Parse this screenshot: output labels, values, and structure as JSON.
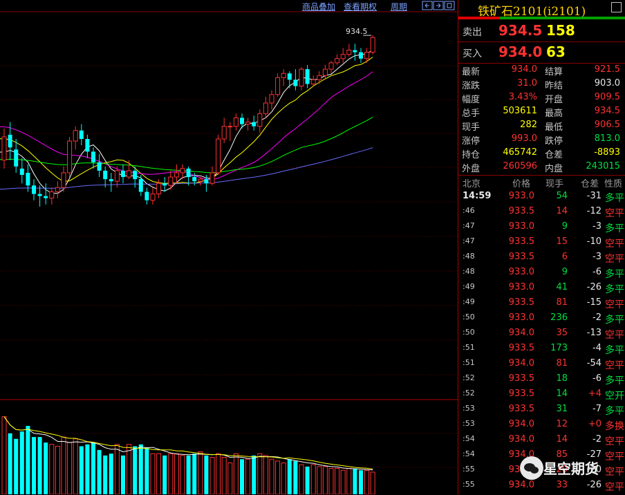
{
  "toolbar": {
    "overlay_label": "商品叠加",
    "history_label": "查看期权",
    "period_label": "周期"
  },
  "chart": {
    "high_label": "934.5",
    "candles": [
      {
        "o": 905.0,
        "c": 910.5,
        "h": 912.5,
        "l": 903.0
      },
      {
        "o": 911.0,
        "c": 908.0,
        "h": 914.0,
        "l": 905.0
      },
      {
        "o": 907.5,
        "c": 903.5,
        "h": 910.0,
        "l": 902.0
      },
      {
        "o": 903.0,
        "c": 901.5,
        "h": 905.5,
        "l": 899.5
      },
      {
        "o": 902.0,
        "c": 899.0,
        "h": 904.0,
        "l": 897.5
      },
      {
        "o": 899.0,
        "c": 897.0,
        "h": 900.5,
        "l": 895.5
      },
      {
        "o": 897.0,
        "c": 896.5,
        "h": 899.0,
        "l": 894.0
      },
      {
        "o": 896.5,
        "c": 896.0,
        "h": 899.5,
        "l": 894.5
      },
      {
        "o": 896.0,
        "c": 897.5,
        "h": 898.5,
        "l": 894.5
      },
      {
        "o": 897.5,
        "c": 898.5,
        "h": 900.0,
        "l": 896.0
      },
      {
        "o": 898.5,
        "c": 902.0,
        "h": 903.5,
        "l": 897.5
      },
      {
        "o": 902.0,
        "c": 909.5,
        "h": 910.5,
        "l": 901.0
      },
      {
        "o": 909.5,
        "c": 912.0,
        "h": 913.0,
        "l": 907.5
      },
      {
        "o": 912.0,
        "c": 910.0,
        "h": 913.5,
        "l": 908.5
      },
      {
        "o": 910.0,
        "c": 907.0,
        "h": 911.0,
        "l": 905.5
      },
      {
        "o": 907.0,
        "c": 904.5,
        "h": 908.0,
        "l": 903.0
      },
      {
        "o": 904.5,
        "c": 902.5,
        "h": 906.5,
        "l": 901.0
      },
      {
        "o": 902.5,
        "c": 900.5,
        "h": 903.5,
        "l": 898.5
      },
      {
        "o": 900.5,
        "c": 900.0,
        "h": 902.0,
        "l": 897.5
      },
      {
        "o": 900.0,
        "c": 902.5,
        "h": 903.5,
        "l": 898.5
      },
      {
        "o": 902.5,
        "c": 901.0,
        "h": 904.0,
        "l": 899.5
      },
      {
        "o": 901.0,
        "c": 902.5,
        "h": 905.0,
        "l": 900.5
      },
      {
        "o": 902.5,
        "c": 900.5,
        "h": 903.5,
        "l": 898.5
      },
      {
        "o": 900.5,
        "c": 897.5,
        "h": 901.5,
        "l": 896.5
      },
      {
        "o": 897.5,
        "c": 895.5,
        "h": 898.5,
        "l": 894.5
      },
      {
        "o": 895.5,
        "c": 897.0,
        "h": 898.5,
        "l": 894.5
      },
      {
        "o": 897.0,
        "c": 899.5,
        "h": 900.5,
        "l": 896.0
      },
      {
        "o": 899.5,
        "c": 899.0,
        "h": 901.0,
        "l": 897.5
      },
      {
        "o": 899.0,
        "c": 901.0,
        "h": 902.5,
        "l": 898.0
      },
      {
        "o": 901.0,
        "c": 902.0,
        "h": 904.0,
        "l": 899.5
      },
      {
        "o": 902.0,
        "c": 903.0,
        "h": 904.0,
        "l": 900.5
      },
      {
        "o": 903.0,
        "c": 901.0,
        "h": 903.5,
        "l": 899.0
      },
      {
        "o": 901.0,
        "c": 900.0,
        "h": 902.0,
        "l": 899.0
      },
      {
        "o": 900.0,
        "c": 900.5,
        "h": 901.0,
        "l": 899.0
      },
      {
        "o": 900.5,
        "c": 899.5,
        "h": 901.5,
        "l": 897.5
      },
      {
        "o": 899.5,
        "c": 902.0,
        "h": 903.5,
        "l": 899.0
      },
      {
        "o": 902.0,
        "c": 910.0,
        "h": 911.0,
        "l": 901.5
      },
      {
        "o": 910.0,
        "c": 913.0,
        "h": 915.0,
        "l": 909.0
      },
      {
        "o": 913.0,
        "c": 913.0,
        "h": 914.0,
        "l": 909.5
      },
      {
        "o": 913.0,
        "c": 915.0,
        "h": 916.0,
        "l": 912.0
      },
      {
        "o": 915.0,
        "c": 913.5,
        "h": 916.0,
        "l": 912.5
      },
      {
        "o": 913.5,
        "c": 914.0,
        "h": 915.0,
        "l": 912.0
      },
      {
        "o": 914.0,
        "c": 913.0,
        "h": 915.5,
        "l": 912.0
      },
      {
        "o": 913.0,
        "c": 916.0,
        "h": 917.0,
        "l": 911.5
      },
      {
        "o": 916.0,
        "c": 918.5,
        "h": 920.0,
        "l": 915.0
      },
      {
        "o": 918.5,
        "c": 920.5,
        "h": 921.5,
        "l": 917.0
      },
      {
        "o": 920.5,
        "c": 924.5,
        "h": 925.5,
        "l": 920.0
      },
      {
        "o": 924.5,
        "c": 925.5,
        "h": 926.5,
        "l": 922.5
      },
      {
        "o": 925.5,
        "c": 924.0,
        "h": 926.0,
        "l": 922.0
      },
      {
        "o": 924.0,
        "c": 922.5,
        "h": 926.5,
        "l": 921.5
      },
      {
        "o": 922.5,
        "c": 926.5,
        "h": 927.0,
        "l": 921.5
      },
      {
        "o": 926.5,
        "c": 923.0,
        "h": 927.5,
        "l": 922.0
      },
      {
        "o": 923.0,
        "c": 924.0,
        "h": 925.0,
        "l": 922.5
      },
      {
        "o": 924.0,
        "c": 925.0,
        "h": 926.0,
        "l": 923.0
      },
      {
        "o": 925.0,
        "c": 926.5,
        "h": 927.5,
        "l": 924.0
      },
      {
        "o": 926.5,
        "c": 928.0,
        "h": 928.5,
        "l": 925.5
      },
      {
        "o": 928.0,
        "c": 929.0,
        "h": 930.0,
        "l": 927.5
      },
      {
        "o": 929.0,
        "c": 930.0,
        "h": 931.5,
        "l": 928.0
      },
      {
        "o": 930.0,
        "c": 931.0,
        "h": 932.5,
        "l": 929.5
      },
      {
        "o": 931.0,
        "c": 930.5,
        "h": 932.5,
        "l": 928.5
      },
      {
        "o": 930.5,
        "c": 929.0,
        "h": 931.5,
        "l": 928.0
      },
      {
        "o": 929.0,
        "c": 930.5,
        "h": 931.5,
        "l": 928.0
      },
      {
        "o": 930.5,
        "c": 934.0,
        "h": 934.5,
        "l": 930.0
      }
    ],
    "volumes": [
      42,
      33,
      30,
      34,
      37,
      31,
      31,
      28,
      27,
      26,
      31,
      28,
      30,
      26,
      27,
      28,
      24,
      21,
      22,
      27,
      21,
      27,
      26,
      27,
      25,
      22,
      22,
      21,
      22,
      22,
      21,
      21,
      22,
      23,
      21,
      20,
      22,
      20,
      17,
      22,
      19,
      19,
      21,
      22,
      21,
      19,
      18,
      17,
      19,
      18,
      16,
      15,
      16,
      15,
      15,
      14,
      14,
      13,
      14,
      14,
      13,
      13,
      12
    ]
  },
  "panel": {
    "title": "铁矿石2101(i2101)",
    "ask_label": "卖出",
    "ask_price": "934.5",
    "ask_vol": "158",
    "bid_label": "买入",
    "bid_price": "934.0",
    "bid_vol": "63",
    "quote_rows": [
      {
        "l1": "最新",
        "v1": "934.0",
        "c1": "red",
        "l2": "结算",
        "v2": "921.5",
        "c2": "red"
      },
      {
        "l1": "涨跌",
        "v1": "31.0",
        "c1": "red",
        "l2": "昨结",
        "v2": "903.0",
        "c2": "white"
      },
      {
        "l1": "幅度",
        "v1": "3.43%",
        "c1": "red",
        "l2": "开盘",
        "v2": "909.5",
        "c2": "red"
      },
      {
        "l1": "总手",
        "v1": "503611",
        "c1": "yellow",
        "l2": "最高",
        "v2": "934.5",
        "c2": "red"
      },
      {
        "l1": "现手",
        "v1": "282",
        "c1": "yellow",
        "l2": "最低",
        "v2": "906.5",
        "c2": "red"
      },
      {
        "l1": "涨停",
        "v1": "993.0",
        "c1": "red",
        "l2": "跌停",
        "v2": "813.0",
        "c2": "green"
      },
      {
        "l1": "持仓",
        "v1": "465742",
        "c1": "yellow",
        "l2": "仓差",
        "v2": "-8893",
        "c2": "yellow"
      },
      {
        "l1": "外盘",
        "v1": "260596",
        "c1": "red",
        "l2": "内盘",
        "v2": "243015",
        "c2": "green"
      }
    ],
    "tick_header": {
      "time": "北京",
      "price": "价格",
      "vol": "现手",
      "oi": "仓差",
      "nature": "性质"
    },
    "ticks": [
      {
        "time": "14:59",
        "price": "933.0",
        "vol": "54",
        "vc": "green",
        "oi": "-31",
        "nature": "多平",
        "nc": "green"
      },
      {
        "time": ":46",
        "price": "933.5",
        "vol": "14",
        "vc": "red",
        "oi": "-12",
        "nature": "空平",
        "nc": "red"
      },
      {
        "time": ":47",
        "price": "933.0",
        "vol": "9",
        "vc": "green",
        "oi": "-3",
        "nature": "多平",
        "nc": "green"
      },
      {
        "time": ":47",
        "price": "933.5",
        "vol": "15",
        "vc": "red",
        "oi": "-10",
        "nature": "空平",
        "nc": "red"
      },
      {
        "time": ":48",
        "price": "933.5",
        "vol": "6",
        "vc": "red",
        "oi": "-3",
        "nature": "空平",
        "nc": "red"
      },
      {
        "time": ":48",
        "price": "933.0",
        "vol": "9",
        "vc": "green",
        "oi": "-6",
        "nature": "多平",
        "nc": "green"
      },
      {
        "time": ":49",
        "price": "933.0",
        "vol": "41",
        "vc": "green",
        "oi": "-26",
        "nature": "多平",
        "nc": "green"
      },
      {
        "time": ":49",
        "price": "933.5",
        "vol": "81",
        "vc": "red",
        "oi": "-15",
        "nature": "空平",
        "nc": "red"
      },
      {
        "time": ":50",
        "price": "933.0",
        "vol": "236",
        "vc": "green",
        "oi": "-2",
        "nature": "多平",
        "nc": "green"
      },
      {
        "time": ":50",
        "price": "934.0",
        "vol": "35",
        "vc": "red",
        "oi": "-13",
        "nature": "空平",
        "nc": "red"
      },
      {
        "time": ":51",
        "price": "933.5",
        "vol": "173",
        "vc": "green",
        "oi": "-4",
        "nature": "多平",
        "nc": "green"
      },
      {
        "time": ":51",
        "price": "934.0",
        "vol": "81",
        "vc": "red",
        "oi": "-54",
        "nature": "空平",
        "nc": "red"
      },
      {
        "time": ":52",
        "price": "933.5",
        "vol": "18",
        "vc": "green",
        "oi": "-6",
        "nature": "多平",
        "nc": "green"
      },
      {
        "time": ":52",
        "price": "933.5",
        "vol": "14",
        "vc": "green",
        "oi": "+4",
        "nature": "空开",
        "nc": "green"
      },
      {
        "time": ":53",
        "price": "933.5",
        "vol": "31",
        "vc": "green",
        "oi": "-7",
        "nature": "多平",
        "nc": "green"
      },
      {
        "time": ":53",
        "price": "934.0",
        "vol": "12",
        "vc": "red",
        "oi": "+0",
        "nature": "多换",
        "nc": "red"
      },
      {
        "time": ":54",
        "price": "934.0",
        "vol": "14",
        "vc": "red",
        "oi": "-2",
        "nature": "空平",
        "nc": "red"
      },
      {
        "time": ":54",
        "price": "934.0",
        "vol": "85",
        "vc": "red",
        "oi": "-27",
        "nature": "空平",
        "nc": "red"
      },
      {
        "time": ":55",
        "price": "934.0",
        "vol": "20",
        "vc": "red",
        "oi": "-20",
        "nature": "空平",
        "nc": "red"
      },
      {
        "time": ":55",
        "price": "934.0",
        "vol": "33",
        "vc": "red",
        "oi": "-26",
        "nature": "空平",
        "nc": "red"
      }
    ]
  },
  "watermark": {
    "text": "星空期货"
  }
}
